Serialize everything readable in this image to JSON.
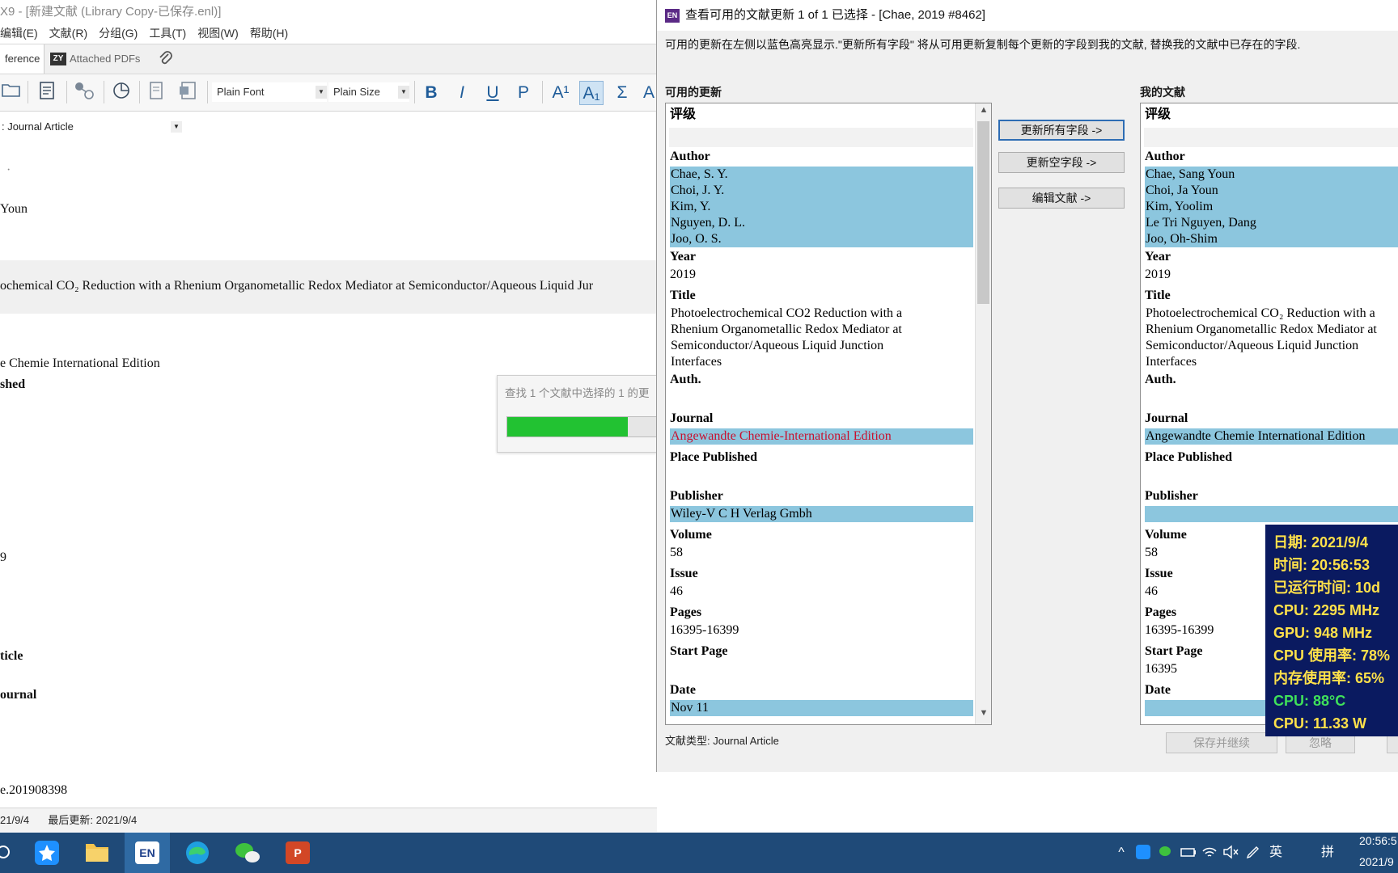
{
  "main_window": {
    "title": "X9 - [新建文献 (Library Copy-已保存.enl)]",
    "menus": [
      "编辑(E)",
      "文献(R)",
      "分组(G)",
      "工具(T)",
      "视图(W)",
      "帮助(H)"
    ],
    "tabs": {
      "reference": "ference",
      "attached_pdfs": "Attached PDFs",
      "zy_logo": "ZY"
    },
    "toolbar": {
      "font": "Plain Font",
      "size": "Plain Size",
      "bold": "B",
      "italic": "I",
      "underline": "U",
      "plain": "P",
      "superscript": "A¹",
      "subscript": "A₁",
      "symbol": "Σ",
      "extra": "A"
    },
    "reference_type": ": Journal Article",
    "fields": {
      "dot": "·",
      "author_fragment": "Youn",
      "title_line": "ochemical CO₂ Reduction with a Rhenium Organometallic Redox Mediator at Semiconductor/Aqueous Liquid Jur",
      "journal_fragment": "e Chemie International Edition",
      "label_published": "shed",
      "year_fragment": "9",
      "label_article": "ticle",
      "label_journal": "ournal",
      "doi_fragment": "e.201908398"
    },
    "progress": {
      "label": "查找 1 个文献中选择的 1 的更",
      "fraction": 0.75
    },
    "status_bar": {
      "created": "21/9/4",
      "updated_label": "最后更新:",
      "updated": "2021/9/4"
    }
  },
  "dialog": {
    "title": "查看可用的文献更新 1 of 1 已选择 - [Chae, 2019 #8462]",
    "app_icon": "EN",
    "description": "可用的更新在左侧以蓝色高亮显示.\"更新所有字段\" 将从可用更新复制每个更新的字段到我的文献, 替换我的文献中已存在的字段.",
    "available_label": "可用的更新",
    "mine_label": "我的文献",
    "buttons": {
      "update_all": "更新所有字段 ->",
      "update_empty": "更新空字段 ->",
      "edit_ref": "编辑文献 ->"
    },
    "ref_type_label": "文献类型: Journal Article",
    "bottom_buttons": {
      "save_continue": "保存并继续",
      "ignore": "忽略"
    },
    "available": {
      "rating_label": "评级",
      "author_label": "Author",
      "authors": [
        "Chae, S. Y.",
        "Choi, J. Y.",
        "Kim, Y.",
        "Nguyen, D. L.",
        "Joo, O. S."
      ],
      "year_label": "Year",
      "year": "2019",
      "title_label": "Title",
      "title_lines": [
        "Photoelectrochemical CO2 Reduction with a",
        "Rhenium Organometallic Redox Mediator at",
        "Semiconductor/Aqueous Liquid Junction",
        "Interfaces"
      ],
      "auth_label": "Auth.",
      "journal_label": "Journal",
      "journal": "Angewandte Chemie-International Edition",
      "place_label": "Place Published",
      "publisher_label": "Publisher",
      "publisher": "Wiley-V C H Verlag Gmbh",
      "volume_label": "Volume",
      "volume": "58",
      "issue_label": "Issue",
      "issue": "46",
      "pages_label": "Pages",
      "pages": "16395-16399",
      "start_page_label": "Start Page",
      "date_label": "Date",
      "date": "Nov 11"
    },
    "mine": {
      "rating_label": "评级",
      "author_label": "Author",
      "authors": [
        "Chae, Sang Youn",
        "Choi, Ja Youn",
        "Kim, Yoolim",
        "Le Tri Nguyen, Dang",
        "Joo, Oh-Shim"
      ],
      "year_label": "Year",
      "year": "2019",
      "title_label": "Title",
      "title_lines": [
        "Photoelectrochemical CO₂ Reduction with a",
        "Rhenium Organometallic Redox Mediator at",
        "Semiconductor/Aqueous Liquid Junction",
        "Interfaces"
      ],
      "auth_label": "Auth.",
      "journal_label": "Journal",
      "journal": "Angewandte Chemie International Edition",
      "place_label": "Place Published",
      "publisher_label": "Publisher",
      "volume_label": "Volume",
      "volume": "58",
      "issue_label": "Issue",
      "issue": "46",
      "pages_label": "Pages",
      "pages": "16395-16399",
      "start_page_label": "Start Page",
      "start_page": "16395",
      "date_label": "Date"
    }
  },
  "sysmon": {
    "date": "日期: 2021/9/4",
    "time": "时间: 20:56:53",
    "uptime": "已运行时间: 10d",
    "cpu_freq": "CPU: 2295 MHz",
    "gpu_freq": "GPU: 948 MHz",
    "cpu_usage": "CPU 使用率: 78%",
    "mem_usage": "内存使用率: 65%",
    "cpu_temp": "CPU: 88°C",
    "cpu_power": "CPU: 11.33 W",
    "colors": {
      "main": "#ffe14a",
      "temp": "#3fe05a",
      "bg": "#0a1a60"
    }
  },
  "taskbar": {
    "en_label": "EN",
    "ppt_label": "P",
    "ime_lang": "英",
    "ime_mode": "拼",
    "clock_time": "20:56:5",
    "clock_date": "2021/9"
  },
  "colors": {
    "highlight": "#8cc6de",
    "diff_red": "#c8102e",
    "progress_green": "#22c232",
    "taskbar": "#1f4a78"
  }
}
